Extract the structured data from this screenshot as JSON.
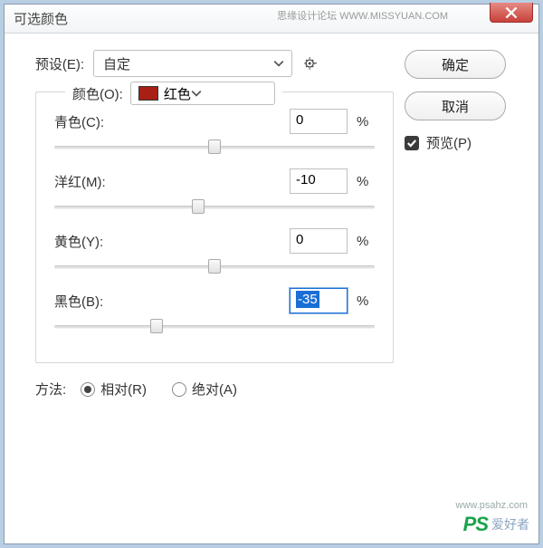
{
  "title": "可选颜色",
  "watermark_top": "思缘设计论坛 WWW.MISSYUAN.COM",
  "preset": {
    "label": "预设(E):",
    "value": "自定"
  },
  "colors_group": {
    "label": "颜色(O):",
    "value": "红色",
    "swatch": "#a81f14"
  },
  "sliders": {
    "cyan": {
      "label": "青色(C):",
      "value": "0",
      "pos": 50
    },
    "magenta": {
      "label": "洋红(M):",
      "value": "-10",
      "pos": 45
    },
    "yellow": {
      "label": "黄色(Y):",
      "value": "0",
      "pos": 50
    },
    "black": {
      "label": "黑色(B):",
      "value": "-35",
      "pos": 32,
      "active": true
    }
  },
  "percent": "%",
  "method": {
    "label": "方法:",
    "relative": "相对(R)",
    "absolute": "绝对(A)"
  },
  "buttons": {
    "ok": "确定",
    "cancel": "取消"
  },
  "preview": "预览(P)",
  "wm_ps": "PS",
  "wm_txt": "爱好者",
  "wm_url": "www.psahz.com"
}
